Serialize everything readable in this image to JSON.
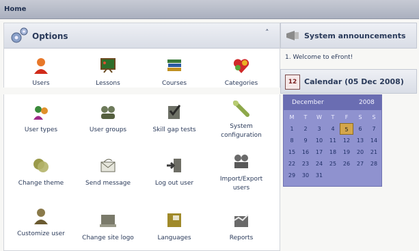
{
  "topbar": {
    "title": "Home"
  },
  "options": {
    "title": "Options",
    "items": [
      {
        "label": "Users",
        "icon": "user-icon"
      },
      {
        "label": "Lessons",
        "icon": "lessons-icon"
      },
      {
        "label": "Courses",
        "icon": "courses-icon"
      },
      {
        "label": "Categories",
        "icon": "categories-icon"
      },
      {
        "label": "User types",
        "icon": "user-types-icon"
      },
      {
        "label": "User groups",
        "icon": "user-groups-icon"
      },
      {
        "label": "Skill gap tests",
        "icon": "skill-gap-tests-icon"
      },
      {
        "label": "System configuration",
        "icon": "system-configuration-icon"
      },
      {
        "label": "Change theme",
        "icon": "change-theme-icon"
      },
      {
        "label": "Send message",
        "icon": "send-message-icon"
      },
      {
        "label": "Log out user",
        "icon": "log-out-user-icon"
      },
      {
        "label": "Import/Export users",
        "icon": "import-export-users-icon"
      },
      {
        "label": "Customize user",
        "icon": "customize-user-icon"
      },
      {
        "label": "Change site logo",
        "icon": "change-site-logo-icon"
      },
      {
        "label": "Languages",
        "icon": "languages-icon"
      },
      {
        "label": "Reports",
        "icon": "reports-icon"
      }
    ]
  },
  "announcements": {
    "title": "System announcements",
    "items": [
      "1. Welcome to eFront!"
    ]
  },
  "calendar": {
    "title": "Calendar (05 Dec 2008)",
    "month": "December",
    "year": "2008",
    "weekdays": [
      "M",
      "T",
      "W",
      "T",
      "F",
      "S",
      "S"
    ],
    "weeks": [
      [
        "1",
        "2",
        "3",
        "4",
        "5",
        "6",
        "7"
      ],
      [
        "8",
        "9",
        "10",
        "11",
        "12",
        "13",
        "14"
      ],
      [
        "15",
        "16",
        "17",
        "18",
        "19",
        "20",
        "21"
      ],
      [
        "22",
        "23",
        "24",
        "25",
        "26",
        "27",
        "28"
      ],
      [
        "29",
        "30",
        "31",
        "",
        "",
        "",
        ""
      ]
    ],
    "highlight": "5"
  }
}
